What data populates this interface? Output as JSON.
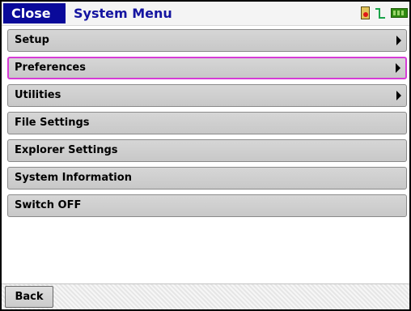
{
  "titlebar": {
    "close_label": "Close",
    "title": "System Menu",
    "status_icons": [
      "sd-card-icon",
      "signal-icon",
      "battery-icon"
    ]
  },
  "menu": {
    "items": [
      {
        "label": "Setup",
        "has_submenu": true
      },
      {
        "label": "Preferences",
        "has_submenu": true,
        "selected": true
      },
      {
        "label": "Utilities",
        "has_submenu": true
      },
      {
        "label": "File Settings",
        "has_submenu": false
      },
      {
        "label": "Explorer Settings",
        "has_submenu": false
      },
      {
        "label": "System Information",
        "has_submenu": false
      },
      {
        "label": "Switch OFF",
        "has_submenu": false
      }
    ]
  },
  "bottombar": {
    "back_label": "Back"
  },
  "colors": {
    "close_bg": "#0a0a9a",
    "title_text": "#1414a0",
    "selection_border": "#d63cd6",
    "item_bg": "#cfcfcf"
  }
}
